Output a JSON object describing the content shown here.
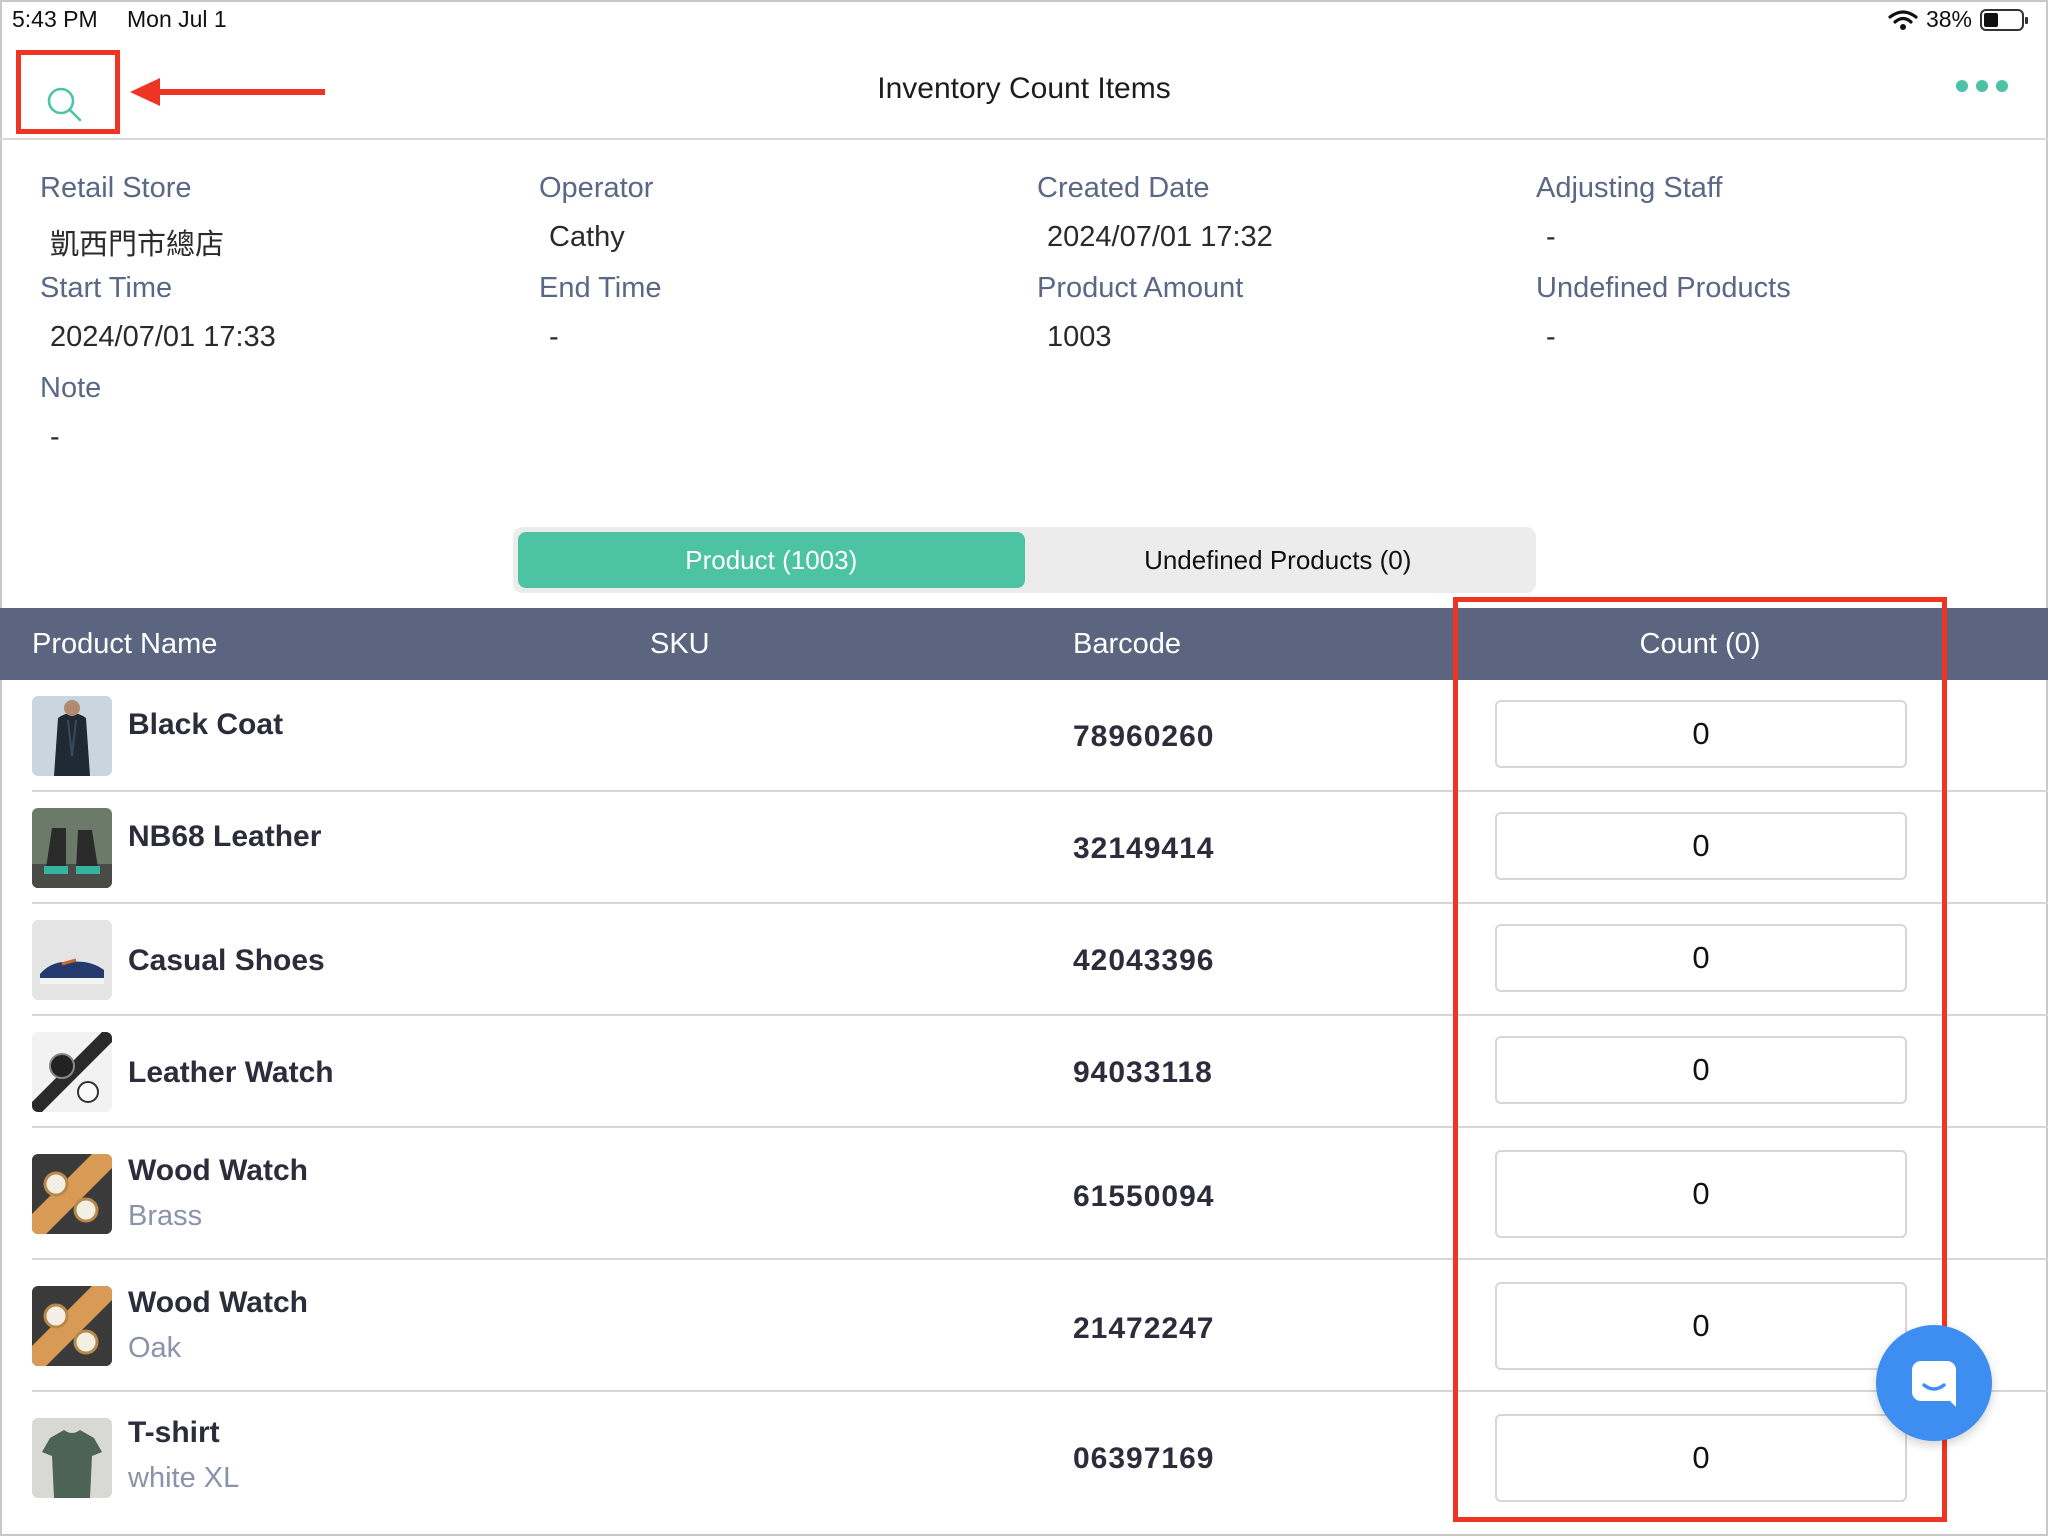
{
  "status_bar": {
    "time": "5:43 PM",
    "date": "Mon Jul 1",
    "battery": "38%",
    "battery_level": 0.38
  },
  "nav": {
    "title": "Inventory Count Items",
    "search_icon": "search-icon",
    "more_icon": "more-horizontal-icon"
  },
  "info": {
    "retail_store": {
      "label": "Retail Store",
      "value": "凱西門市總店"
    },
    "operator": {
      "label": "Operator",
      "value": "Cathy"
    },
    "created_date": {
      "label": "Created Date",
      "value": "2024/07/01 17:32"
    },
    "adjusting_staff": {
      "label": "Adjusting Staff",
      "value": "-"
    },
    "start_time": {
      "label": "Start Time",
      "value": "2024/07/01 17:33"
    },
    "end_time": {
      "label": "End Time",
      "value": "-"
    },
    "product_amount": {
      "label": "Product Amount",
      "value": "1003"
    },
    "undefined_products": {
      "label": "Undefined Products",
      "value": "-"
    },
    "note": {
      "label": "Note",
      "value": "-"
    }
  },
  "tabs": {
    "product": "Product (1003)",
    "undefined": "Undefined Products (0)"
  },
  "table": {
    "headers": {
      "name": "Product Name",
      "sku": "SKU",
      "barcode": "Barcode",
      "count": "Count (0)"
    },
    "rows": [
      {
        "name": "Black Coat",
        "variant": "",
        "barcode": "78960260",
        "count": "0"
      },
      {
        "name": "NB68 Leather",
        "variant": "",
        "barcode": "32149414",
        "count": "0"
      },
      {
        "name": "Casual Shoes",
        "variant": "",
        "barcode": "42043396",
        "count": "0"
      },
      {
        "name": "Leather Watch",
        "variant": "",
        "barcode": "94033118",
        "count": "0"
      },
      {
        "name": "Wood Watch",
        "variant": "Brass",
        "barcode": "61550094",
        "count": "0"
      },
      {
        "name": "Wood Watch",
        "variant": "Oak",
        "barcode": "21472247",
        "count": "0"
      },
      {
        "name": "T-shirt",
        "variant": "white XL",
        "barcode": "06397169",
        "count": "0"
      }
    ]
  },
  "colors": {
    "accent": "#4cc3a3",
    "header_bg": "#5b6580",
    "highlight": "#ee3524",
    "fab": "#3d8ef0"
  },
  "chat_icon": "chat-icon"
}
